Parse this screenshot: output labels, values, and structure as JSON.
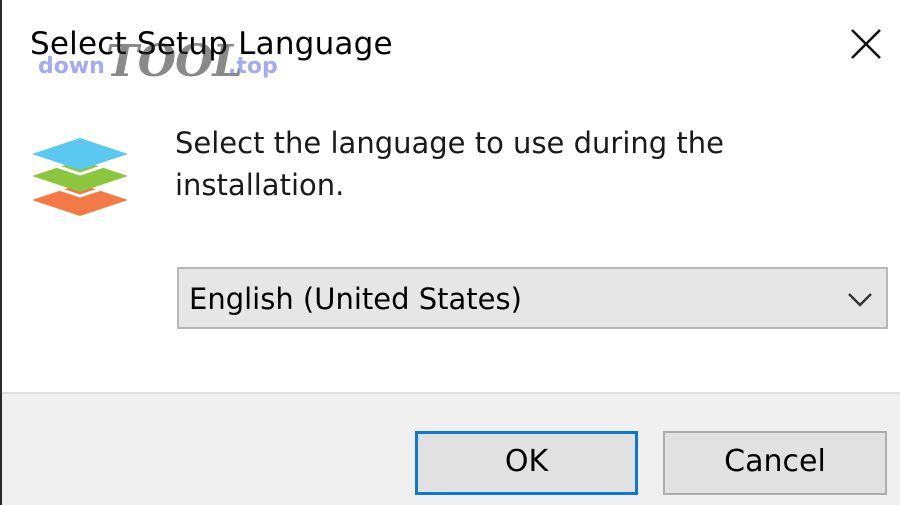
{
  "window": {
    "title": "Select Setup Language",
    "close_icon": "close-icon"
  },
  "watermark": {
    "left": "down",
    "middle": "TOOL",
    "right": ".top"
  },
  "content": {
    "app_icon": "layers-icon",
    "prompt": "Select the language to use during the installation.",
    "language_select": {
      "selected": "English (United States)",
      "icon": "chevron-down-icon"
    }
  },
  "buttons": {
    "ok_label": "OK",
    "cancel_label": "Cancel"
  },
  "colors": {
    "layer_top": "#5bc8f2",
    "layer_middle": "#8cc63e",
    "layer_bottom": "#f47a45",
    "focus_border": "#0a78d7"
  }
}
